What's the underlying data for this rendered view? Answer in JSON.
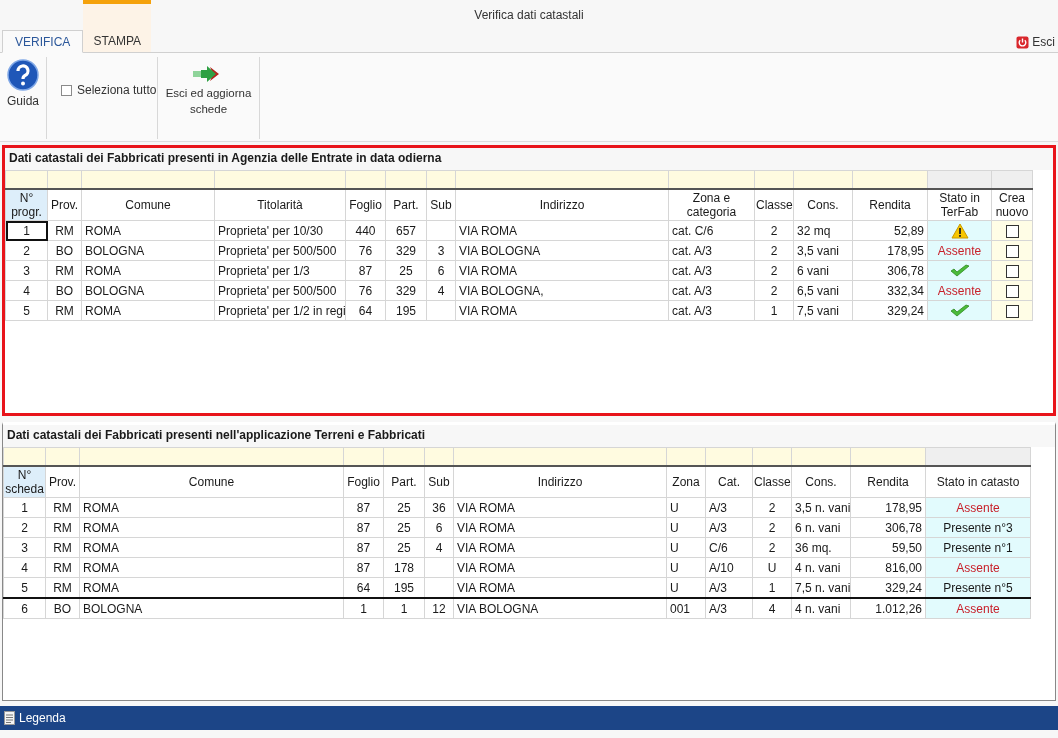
{
  "window": {
    "title": "Verifica dati catastali"
  },
  "tabs": [
    {
      "label": "VERIFICA",
      "selected": true,
      "kind": "plain"
    },
    {
      "label": "STAMPA",
      "selected": false,
      "kind": "contextual"
    }
  ],
  "exit_button": {
    "label": "Esci"
  },
  "ribbon": {
    "help": {
      "label": "Guida"
    },
    "select_all": {
      "label": "Seleziona tutto",
      "checked": false
    },
    "update": {
      "label": "Esci ed aggiorna schede"
    }
  },
  "sections": [
    {
      "title": "Dati catastali dei Fabbricati presenti in Agenzia delle Entrate in data odierna",
      "highlighted": true,
      "columns": [
        "N° progr.",
        "Prov.",
        "Comune",
        "Titolarità",
        "Foglio",
        "Part.",
        "Sub",
        "Indirizzo",
        "Zona e categoria",
        "Classe",
        "Cons.",
        "Rendita",
        "Stato in TerFab",
        "Crea nuovo"
      ],
      "rows": [
        {
          "selected": true,
          "divider_above": false,
          "cells": [
            "1",
            "RM",
            "ROMA",
            "Proprieta' per 10/30",
            "440",
            "657",
            "",
            "VIA ROMA",
            "cat. C/6",
            "2",
            "32 mq",
            "52,89"
          ],
          "status": {
            "kind": "warning"
          },
          "create": {
            "checked": false
          }
        },
        {
          "selected": false,
          "divider_above": false,
          "cells": [
            "2",
            "BO",
            "BOLOGNA",
            "Proprieta' per 500/500",
            "76",
            "329",
            "3",
            "VIA BOLOGNA",
            "cat. A/3",
            "2",
            "3,5 vani",
            "178,95"
          ],
          "status": {
            "kind": "absent",
            "text": "Assente"
          },
          "create": {
            "checked": false
          }
        },
        {
          "selected": false,
          "divider_above": false,
          "cells": [
            "3",
            "RM",
            "ROMA",
            "Proprieta' per 1/3",
            "87",
            "25",
            "6",
            "VIA ROMA",
            "cat. A/3",
            "2",
            "6 vani",
            "306,78"
          ],
          "status": {
            "kind": "ok"
          },
          "create": {
            "checked": false
          }
        },
        {
          "selected": false,
          "divider_above": false,
          "cells": [
            "4",
            "BO",
            "BOLOGNA",
            "Proprieta' per 500/500",
            "76",
            "329",
            "4",
            "VIA BOLOGNA,",
            "cat. A/3",
            "2",
            "6,5 vani",
            "332,34"
          ],
          "status": {
            "kind": "absent",
            "text": "Assente"
          },
          "create": {
            "checked": false
          }
        },
        {
          "selected": false,
          "divider_above": false,
          "cells": [
            "5",
            "RM",
            "ROMA",
            "Proprieta' per 1/2 in regi",
            "64",
            "195",
            "",
            "VIA ROMA",
            "cat. A/3",
            "1",
            "7,5 vani",
            "329,24"
          ],
          "status": {
            "kind": "ok"
          },
          "create": {
            "checked": false
          }
        }
      ]
    },
    {
      "title": "Dati catastali dei Fabbricati presenti nell'applicazione Terreni e Fabbricati",
      "highlighted": false,
      "columns": [
        "N° scheda",
        "Prov.",
        "Comune",
        "Foglio",
        "Part.",
        "Sub",
        "Indirizzo",
        "Zona",
        "Cat.",
        "Classe",
        "Cons.",
        "Rendita",
        "Stato in catasto"
      ],
      "rows": [
        {
          "selected": false,
          "divider_above": false,
          "cells": [
            "1",
            "RM",
            "ROMA",
            "87",
            "25",
            "36",
            "VIA ROMA",
            "U",
            "A/3",
            "2",
            "3,5 n. vani",
            "178,95"
          ],
          "status": {
            "kind": "absent",
            "text": "Assente"
          }
        },
        {
          "selected": false,
          "divider_above": false,
          "cells": [
            "2",
            "RM",
            "ROMA",
            "87",
            "25",
            "6",
            "VIA ROMA",
            "U",
            "A/3",
            "2",
            "6 n. vani",
            "306,78"
          ],
          "status": {
            "kind": "present",
            "text": "Presente n°3"
          }
        },
        {
          "selected": false,
          "divider_above": false,
          "cells": [
            "3",
            "RM",
            "ROMA",
            "87",
            "25",
            "4",
            "VIA ROMA",
            "U",
            "C/6",
            "2",
            "36 mq.",
            "59,50"
          ],
          "status": {
            "kind": "present",
            "text": "Presente n°1"
          }
        },
        {
          "selected": false,
          "divider_above": false,
          "cells": [
            "4",
            "RM",
            "ROMA",
            "87",
            "178",
            "",
            "VIA ROMA",
            "U",
            "A/10",
            "U",
            "4 n. vani",
            "816,00"
          ],
          "status": {
            "kind": "absent",
            "text": "Assente"
          }
        },
        {
          "selected": false,
          "divider_above": false,
          "cells": [
            "5",
            "RM",
            "ROMA",
            "64",
            "195",
            "",
            "VIA ROMA",
            "U",
            "A/3",
            "1",
            "7,5 n. vani",
            "329,24"
          ],
          "status": {
            "kind": "present",
            "text": "Presente n°5"
          }
        },
        {
          "selected": false,
          "divider_above": true,
          "cells": [
            "6",
            "BO",
            "BOLOGNA",
            "1",
            "1",
            "12",
            "VIA BOLOGNA",
            "001",
            "A/3",
            "4",
            "4 n. vani",
            "1.012,26"
          ],
          "status": {
            "kind": "absent",
            "text": "Assente"
          }
        }
      ]
    }
  ],
  "status_bar": {
    "label": "Legenda"
  }
}
